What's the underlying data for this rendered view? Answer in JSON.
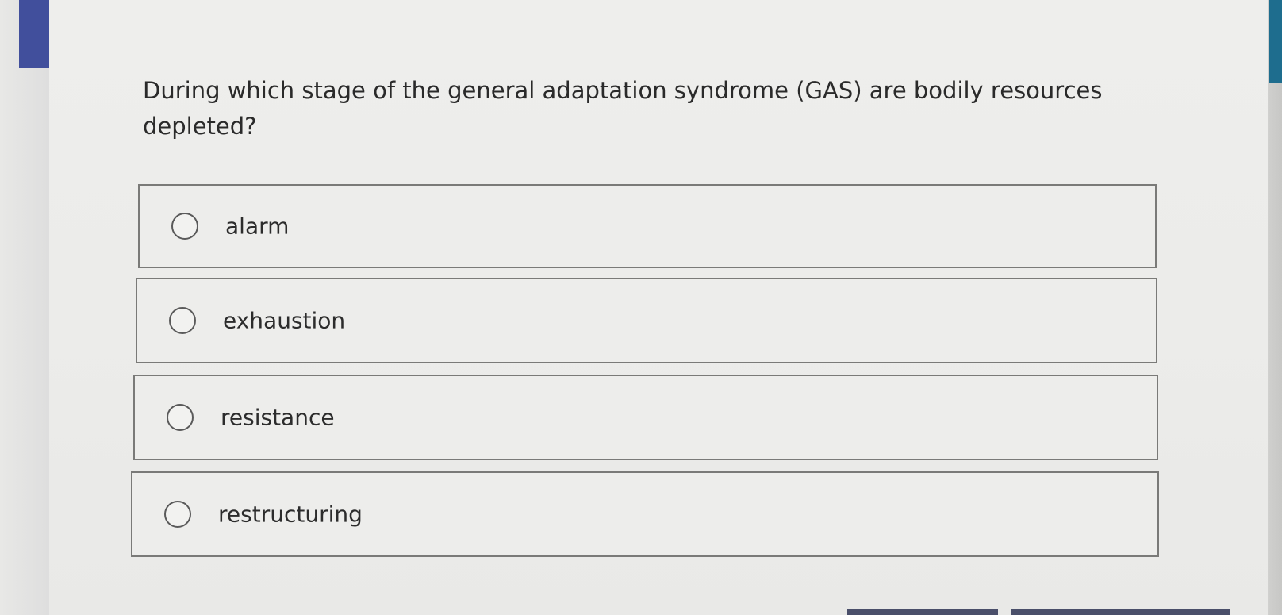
{
  "question": {
    "text": "During which stage of the general adaptation syndrome (GAS) are bodily resources depleted?"
  },
  "options": [
    {
      "label": "alarm",
      "selected": false
    },
    {
      "label": "exhaustion",
      "selected": false
    },
    {
      "label": "resistance",
      "selected": false
    },
    {
      "label": "restructuring",
      "selected": false
    }
  ],
  "colors": {
    "accent": "#414f9c",
    "right_accent": "#1e6d8e"
  }
}
